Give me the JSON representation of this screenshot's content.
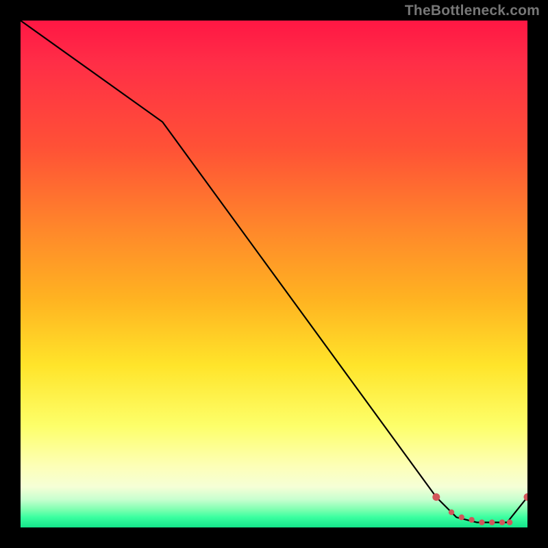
{
  "attribution": "TheBottleneck.com",
  "chart_data": {
    "type": "line",
    "title": "",
    "xlabel": "",
    "ylabel": "",
    "xlim": [
      0,
      100
    ],
    "ylim": [
      0,
      100
    ],
    "grid": false,
    "legend": false,
    "series": [
      {
        "name": "curve",
        "style": "solid-black",
        "x": [
          0,
          28,
          82,
          86,
          90,
          94,
          96,
          100
        ],
        "y": [
          100,
          80,
          6,
          2,
          1,
          1,
          1,
          6
        ]
      },
      {
        "name": "markers",
        "style": "red-dots",
        "x": [
          82,
          85,
          87,
          89,
          91,
          93,
          95,
          96.5,
          100
        ],
        "y": [
          6,
          3,
          2,
          1.5,
          1,
          1,
          1,
          1,
          6
        ]
      }
    ],
    "annotations": []
  }
}
